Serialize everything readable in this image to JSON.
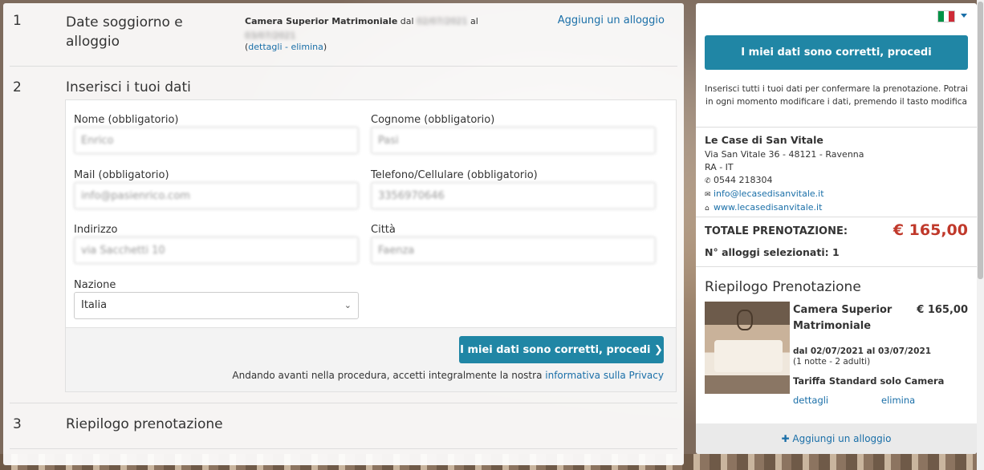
{
  "steps": [
    {
      "num": "1",
      "title": "Date soggiorno e alloggio"
    },
    {
      "num": "2",
      "title": "Inserisci i tuoi dati"
    },
    {
      "num": "3",
      "title": "Riepilogo prenotazione"
    }
  ],
  "stay": {
    "room": "Camera Superior Matrimoniale",
    "from_word": "dal",
    "from_date": "02/07/2021",
    "to_word": "al",
    "to_date": "03/07/2021",
    "details": "dettagli",
    "separator": " - ",
    "remove": "elimina",
    "add_stay": "Aggiungi un alloggio"
  },
  "form": {
    "name_label": "Nome (obbligatorio)",
    "name_value": "Enrico",
    "surname_label": "Cognome (obbligatorio)",
    "surname_value": "Pasi",
    "mail_label": "Mail (obbligatorio)",
    "mail_value": "info@pasienrico.com",
    "phone_label": "Telefono/Cellulare (obbligatorio)",
    "phone_value": "3356970646",
    "address_label": "Indirizzo",
    "address_value": "via Sacchetti 10",
    "city_label": "Città",
    "city_value": "Faenza",
    "country_label": "Nazione",
    "country_value": "Italia",
    "submit": "I miei dati sono corretti, procedi",
    "privacy_prefix": "Andando avanti nella procedura, accetti integralmente la nostra",
    "privacy_link": "informativa sulla Privacy"
  },
  "sidebar": {
    "submit": "I miei dati sono corretti, procedi",
    "note": "Inserisci tutti i tuoi dati per confermare la prenotazione. Potrai in ogni momento modificare i dati, premendo il tasto modifica",
    "hotel_name": "Le Case di San Vitale",
    "address": "Via San Vitale 36 - 48121 - Ravenna",
    "province": "RA - IT",
    "phone": "0544 218304",
    "email": "info@lecasedisanvitale.it",
    "website": "www.lecasedisanvitale.it",
    "total_label": "TOTALE PRENOTAZIONE:",
    "total_value": "€ 165,00",
    "units_label": "N° alloggi selezionati: 1",
    "summary_title": "Riepilogo Prenotazione",
    "room_name": "Camera Superior Matrimoniale",
    "room_price": "€ 165,00",
    "room_dates": "dal 02/07/2021 al 03/07/2021",
    "room_guests": "(1 notte - 2 adulti)",
    "room_rate": "Tariffa Standard solo Camera",
    "room_details": "dettagli",
    "room_remove": "elimina",
    "add_stay": "Aggiungi un alloggio"
  },
  "flag_colors": [
    "#009246",
    "#ffffff",
    "#ce2b37"
  ],
  "icons": {
    "phone": "phone-icon",
    "mail": "envelope-icon",
    "web": "home-icon",
    "add": "plus-icon",
    "select": "chevron-down-icon",
    "next": "chevron-right-icon"
  }
}
